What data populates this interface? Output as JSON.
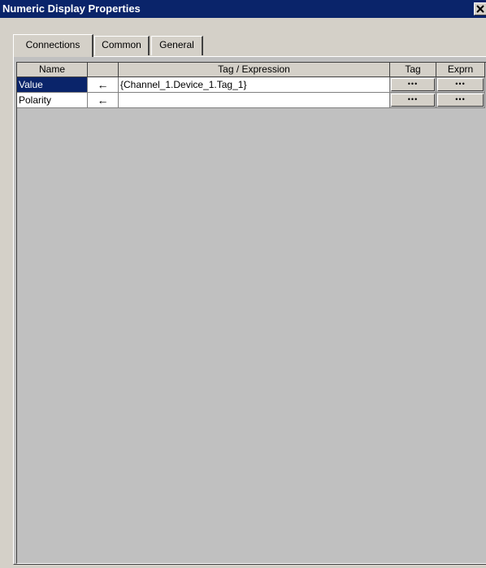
{
  "window": {
    "title": "Numeric Display Properties",
    "close_label": "✕"
  },
  "tabs": [
    {
      "label": "Connections",
      "active": true
    },
    {
      "label": "Common",
      "active": false
    },
    {
      "label": "General",
      "active": false
    }
  ],
  "grid": {
    "columns": [
      "Name",
      "",
      "Tag / Expression",
      "Tag",
      "Exprn"
    ],
    "rows": [
      {
        "name": "Value",
        "direction": "←",
        "expression": "{Channel_1.Device_1.Tag_1}",
        "tag_button": "•••",
        "exprn_button": "•••",
        "selected": true
      },
      {
        "name": "Polarity",
        "direction": "←",
        "expression": "",
        "tag_button": "•••",
        "exprn_button": "•••",
        "selected": false
      }
    ]
  },
  "colors": {
    "titlebar": "#0a246a",
    "selection": "#0a246a",
    "face": "#d4d0c8",
    "grid_background": "#c0c0c0"
  },
  "icons": {
    "close": "close-icon",
    "arrow": "arrow-left-icon",
    "browse": "ellipsis-icon"
  }
}
